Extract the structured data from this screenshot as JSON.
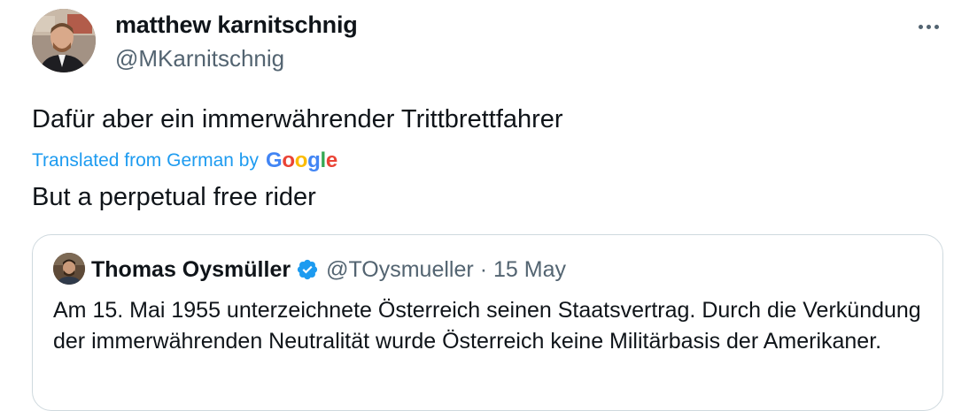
{
  "author": {
    "name": "matthew karnitschnig",
    "handle": "@MKarnitschnig"
  },
  "tweet": {
    "text": "Dafür aber ein immerwährender Trittbrettfahrer",
    "translation_label": "Translated from German by",
    "translation_provider": "Google",
    "translation_text": "But a perpetual free rider"
  },
  "quote": {
    "name": "Thomas Oysmüller",
    "handle": "@TOysmueller",
    "separator": "·",
    "date": "15 May",
    "text": "Am 15. Mai 1955 unterzeichnete Österreich seinen Staatsvertrag. Durch die Verkündung der immerwährenden Neutralität wurde Österreich keine Militärbasis der Amerikaner."
  },
  "icons": {
    "more": "more-horizontal-icon",
    "verified": "verified-badge-icon"
  },
  "colors": {
    "accent": "#1d9bf0",
    "secondary_text": "#536471",
    "primary_text": "#0f1419",
    "border": "#cfd9de"
  }
}
